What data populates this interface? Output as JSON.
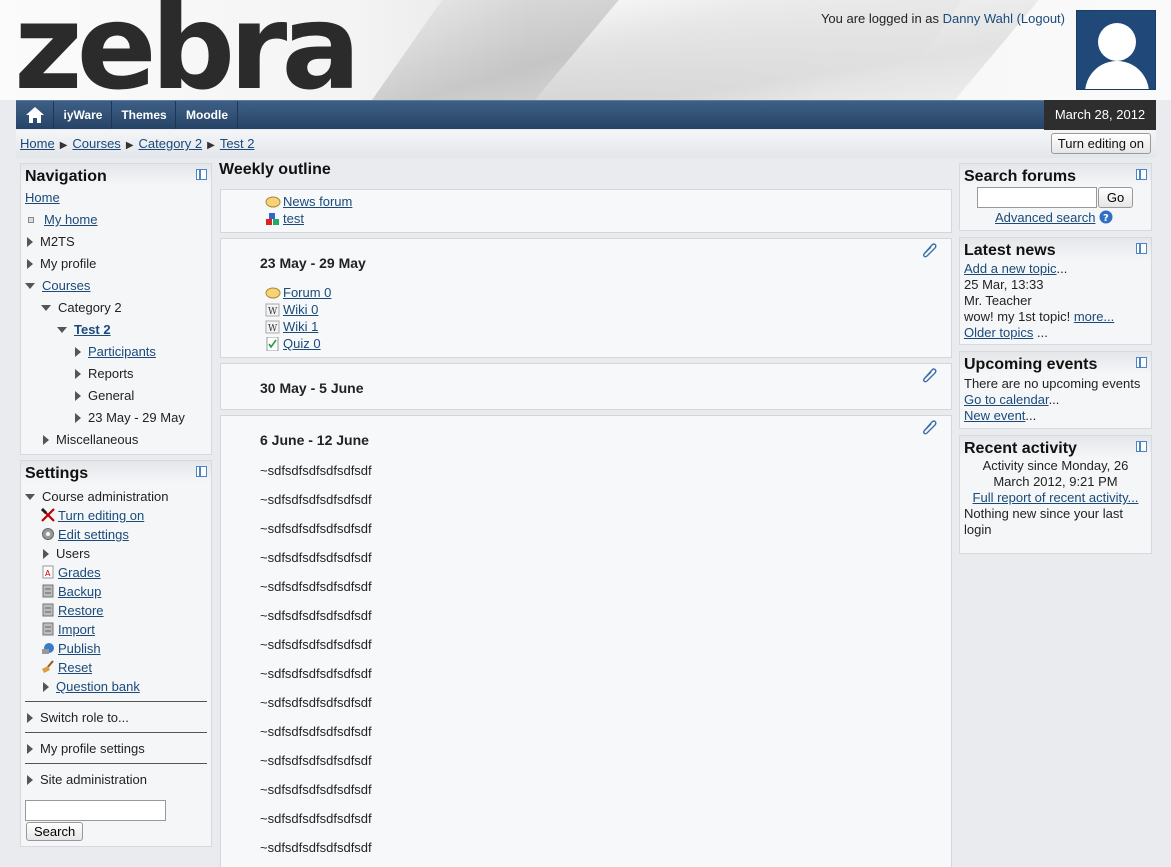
{
  "header": {
    "logo": "zebra",
    "login_prefix": "You are logged in as ",
    "user_name": "Danny Wahl",
    "logout": "(Logout)"
  },
  "navbar": {
    "items": [
      "iyWare",
      "Themes",
      "Moodle"
    ],
    "date": "March 28, 2012"
  },
  "breadcrumb": [
    "Home",
    "Courses",
    "Category 2",
    "Test 2"
  ],
  "edit_button": "Turn editing on",
  "navigation": {
    "title": "Navigation",
    "home": "Home",
    "my_home": "My home",
    "m2ts": "M2TS",
    "my_profile": "My profile",
    "courses": "Courses",
    "category": "Category 2",
    "course": "Test 2",
    "participants": "Participants",
    "reports": "Reports",
    "general": "General",
    "week": "23 May - 29 May",
    "misc": "Miscellaneous"
  },
  "settings": {
    "title": "Settings",
    "course_admin": "Course administration",
    "items": [
      "Turn editing on",
      "Edit settings",
      "Users",
      "Grades",
      "Backup",
      "Restore",
      "Import",
      "Publish",
      "Reset",
      "Question bank"
    ],
    "switch_role": "Switch role to...",
    "profile_settings": "My profile settings",
    "site_admin": "Site administration",
    "search_button": "Search"
  },
  "main": {
    "title": "Weekly outline",
    "top_activities": [
      "News forum",
      "test"
    ],
    "weeks": [
      {
        "title": "23 May - 29 May",
        "activities": [
          "Forum 0",
          "Wiki 0",
          "Wiki 1",
          "Quiz 0"
        ]
      },
      {
        "title": "30 May - 5 June"
      },
      {
        "title": "6 June - 12 June",
        "lines": [
          "~sdfsdfsdfsdfsdfsdf",
          "~sdfsdfsdfsdfsdfsdf",
          "~sdfsdfsdfsdfsdfsdf",
          "~sdfsdfsdfsdfsdfsdf",
          "~sdfsdfsdfsdfsdfsdf",
          "~sdfsdfsdfsdfsdfsdf",
          "~sdfsdfsdfsdfsdfsdf",
          "~sdfsdfsdfsdfsdfsdf",
          "~sdfsdfsdfsdfsdfsdf",
          "~sdfsdfsdfsdfsdfsdf",
          "~sdfsdfsdfsdfsdfsdf",
          "~sdfsdfsdfsdfsdfsdf",
          "~sdfsdfsdfsdfsdfsdf",
          "~sdfsdfsdfsdfsdfsdf"
        ]
      }
    ]
  },
  "search_forums": {
    "title": "Search forums",
    "go": "Go",
    "advanced": "Advanced search"
  },
  "latest_news": {
    "title": "Latest news",
    "add": "Add a new topic",
    "ellipsis": "...",
    "date": "25 Mar, 13:33",
    "author": "Mr. Teacher",
    "snippet": "wow! my 1st topic! ",
    "more": "more...",
    "older": "Older topics",
    "older_suffix": " ..."
  },
  "upcoming": {
    "title": "Upcoming events",
    "none": "There are no upcoming events",
    "calendar": "Go to calendar",
    "new_event": "New event",
    "ellipsis": "..."
  },
  "recent": {
    "title": "Recent activity",
    "since_line1": "Activity since Monday, 26",
    "since_line2": "March 2012, 9:21 PM",
    "full_report": "Full report of recent activity...",
    "nothing_line1": "Nothing new since your last",
    "nothing_line2": "login"
  }
}
